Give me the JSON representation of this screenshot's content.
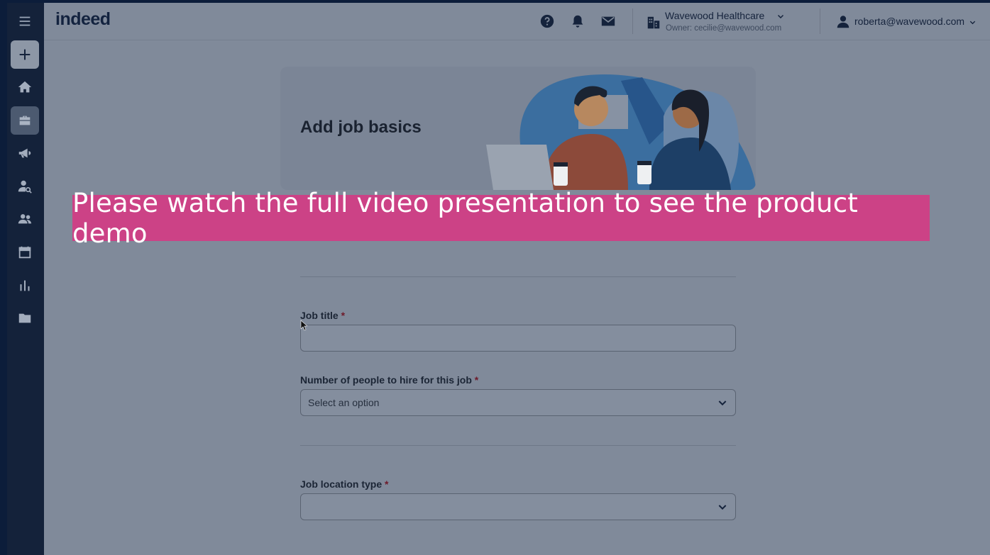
{
  "brand": {
    "logo": "indeed"
  },
  "sidebar": {
    "items": [
      {
        "name": "menu-icon"
      },
      {
        "name": "add-icon"
      },
      {
        "name": "home-icon"
      },
      {
        "name": "jobs-icon"
      },
      {
        "name": "megaphone-icon"
      },
      {
        "name": "candidate-search-icon"
      },
      {
        "name": "people-icon"
      },
      {
        "name": "calendar-icon"
      },
      {
        "name": "analytics-icon"
      },
      {
        "name": "folder-icon"
      }
    ]
  },
  "header": {
    "company_name": "Wavewood Healthcare",
    "company_owner": "Owner: cecilie@wavewood.com",
    "user_email": "roberta@wavewood.com",
    "icons": [
      "help-icon",
      "bell-icon",
      "mail-icon",
      "building-icon",
      "user-icon"
    ]
  },
  "hero": {
    "title": "Add job basics"
  },
  "banner": {
    "text": "Please watch the full video presentation to see the product demo"
  },
  "form": {
    "job_title": {
      "label": "Job title",
      "required": "*",
      "value": ""
    },
    "hire_count": {
      "label": "Number of people to hire for this job",
      "required": "*",
      "placeholder": "Select an option"
    },
    "location_type": {
      "label": "Job location type",
      "required": "*",
      "value": ""
    }
  },
  "colors": {
    "sidebar": "#14223a",
    "content_overlay": "#808a9a",
    "banner": "#cc4286",
    "logo": "#13233f"
  }
}
